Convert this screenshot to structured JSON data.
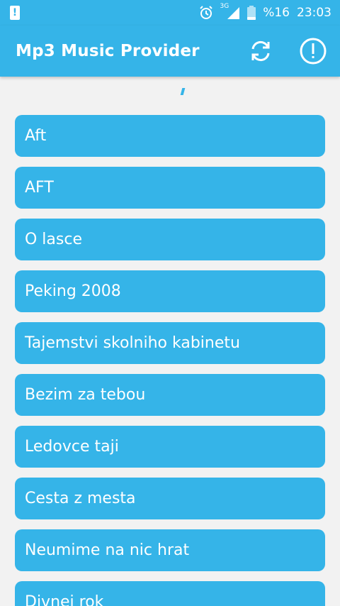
{
  "status_bar": {
    "battery_percent": "%16",
    "time": "23:03",
    "network_type": "3G"
  },
  "app_bar": {
    "title": "Mp3 Music Provider"
  },
  "icons": {
    "refresh": "refresh-icon",
    "info": "info-alert-icon"
  },
  "colors": {
    "primary": "#35b4e8",
    "background": "#f2f2f2"
  },
  "songs": [
    {
      "title": "Aft"
    },
    {
      "title": "AFT"
    },
    {
      "title": "O lasce"
    },
    {
      "title": "Peking 2008"
    },
    {
      "title": "Tajemstvi skolniho kabinetu"
    },
    {
      "title": "Bezim za tebou"
    },
    {
      "title": "Ledovce taji"
    },
    {
      "title": "Cesta z mesta"
    },
    {
      "title": "Neumime na nic hrat"
    },
    {
      "title": "Divnej rok"
    }
  ]
}
